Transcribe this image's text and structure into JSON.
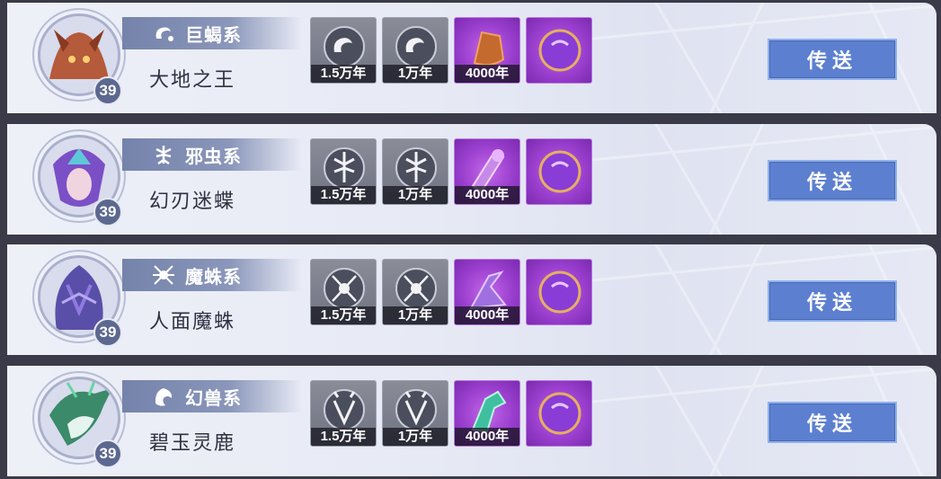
{
  "rows": [
    {
      "system": "巨蝎系",
      "name": "大地之王",
      "level": "39",
      "portrait_color": "#b55a3a",
      "accent": "#d3704a",
      "slots": [
        {
          "age": "1.5万年"
        },
        {
          "age": "1万年"
        },
        {
          "age": "4000年"
        },
        {
          "age": ""
        }
      ],
      "button": "传送"
    },
    {
      "system": "邪虫系",
      "name": "幻刃迷蝶",
      "level": "39",
      "portrait_color": "#7b4fc6",
      "accent": "#5fc8d8",
      "slots": [
        {
          "age": "1.5万年"
        },
        {
          "age": "1万年"
        },
        {
          "age": "4000年"
        },
        {
          "age": ""
        }
      ],
      "button": "传送"
    },
    {
      "system": "魔蛛系",
      "name": "人面魔蛛",
      "level": "39",
      "portrait_color": "#5a4fa8",
      "accent": "#8f7be0",
      "slots": [
        {
          "age": "1.5万年"
        },
        {
          "age": "1万年"
        },
        {
          "age": "4000年"
        },
        {
          "age": ""
        }
      ],
      "button": "传送"
    },
    {
      "system": "幻兽系",
      "name": "碧玉灵鹿",
      "level": "39",
      "portrait_color": "#3b8a6a",
      "accent": "#64d6a4",
      "slots": [
        {
          "age": "1.5万年"
        },
        {
          "age": "1万年"
        },
        {
          "age": "4000年"
        },
        {
          "age": ""
        }
      ],
      "button": "传送"
    }
  ]
}
